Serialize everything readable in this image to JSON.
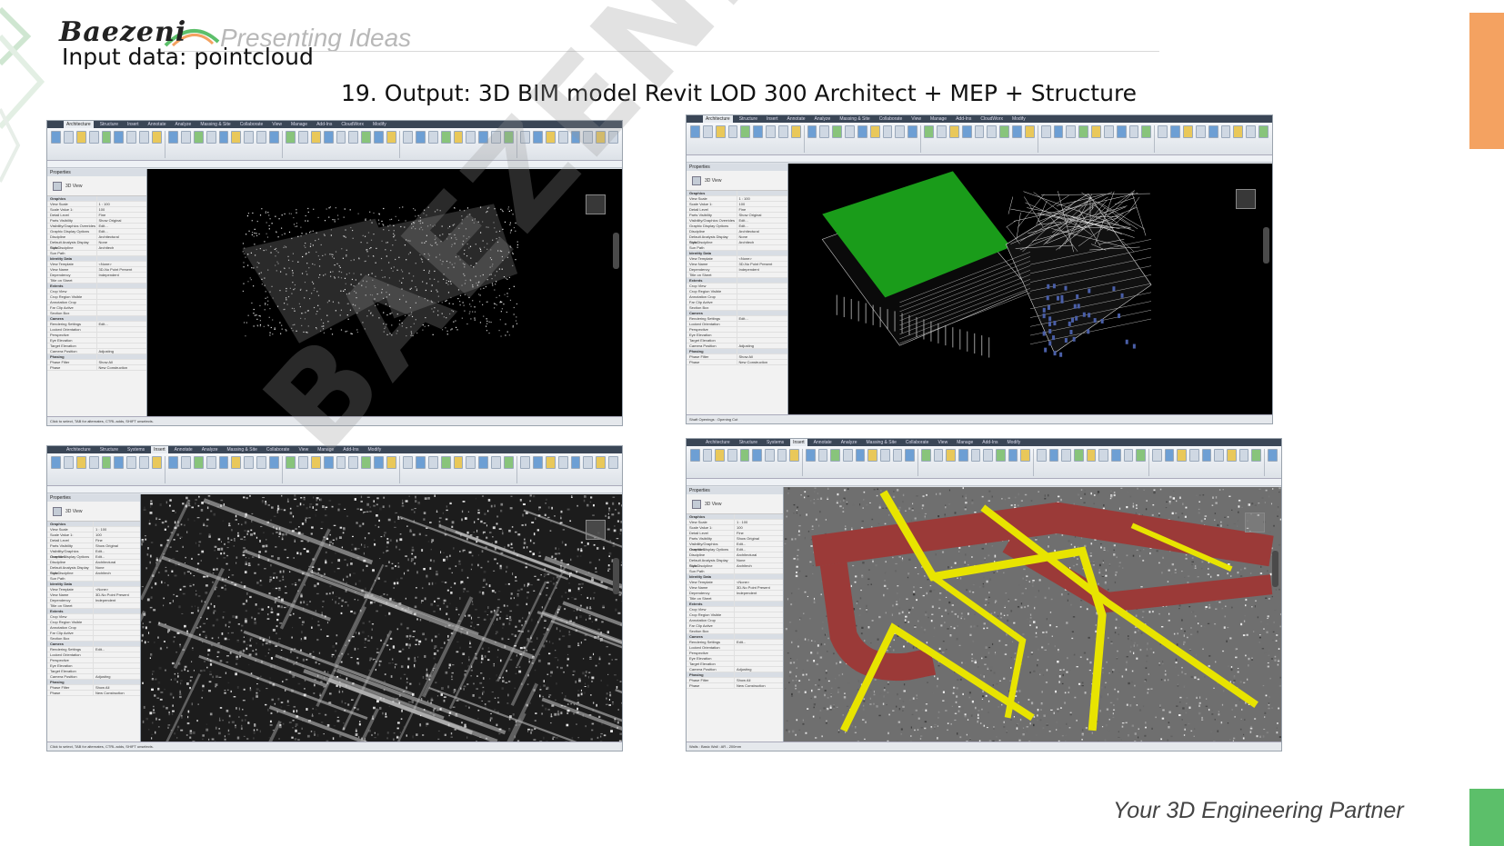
{
  "header": {
    "logo_text": "Baezeni",
    "tagline": "Presenting Ideas",
    "subtitle": "Input data: pointcloud",
    "title": "19. Output: 3D BIM model Revit LOD 300 Architect + MEP + Structure"
  },
  "footer": {
    "tagline": "Your 3D Engineering Partner"
  },
  "watermark": "BAEZENI.COM",
  "colors": {
    "accent_orange": "#f4a261",
    "accent_green": "#5cbf6a",
    "roof_green": "#1a9c1a",
    "pipe_yellow": "#e8e400",
    "duct_red": "#9b3a38"
  },
  "windows": [
    {
      "tabs": [
        "Architecture",
        "Structure",
        "Insert",
        "Annotate",
        "Analyze",
        "Massing & Site",
        "Collaborate",
        "View",
        "Manage",
        "Add-Ins",
        "CloudWorx",
        "Modify"
      ],
      "active_tab": "Architecture",
      "props_title": "Properties",
      "view_type": "3D View",
      "status": "Click to select, TAB for alternates, CTRL adds, SHIFT unselects.",
      "content": "pointcloud-building"
    },
    {
      "tabs": [
        "Architecture",
        "Structure",
        "Insert",
        "Annotate",
        "Analyze",
        "Massing & Site",
        "Collaborate",
        "View",
        "Manage",
        "Add-Ins",
        "CloudWorx",
        "Modify"
      ],
      "active_tab": "Architecture",
      "props_title": "Properties",
      "view_type": "3D View",
      "status": "Shaft Openings : Opening Cut",
      "content": "bim-building"
    },
    {
      "tabs": [
        "Architecture",
        "Structure",
        "Systems",
        "Insert",
        "Annotate",
        "Analyze",
        "Massing & Site",
        "Collaborate",
        "View",
        "Manage",
        "Add-Ins",
        "Modify"
      ],
      "active_tab": "Insert",
      "props_title": "Properties",
      "view_type": "3D View",
      "status": "Click to select, TAB for alternates, CTRL adds, SHIFT unselects.",
      "content": "pointcloud-interior"
    },
    {
      "tabs": [
        "Architecture",
        "Structure",
        "Systems",
        "Insert",
        "Annotate",
        "Analyze",
        "Massing & Site",
        "Collaborate",
        "View",
        "Manage",
        "Add-Ins",
        "Modify"
      ],
      "active_tab": "Insert",
      "props_title": "Properties",
      "view_type": "3D View",
      "status": "Walls : Basic Wall : AR - 200mm",
      "content": "mep-interior"
    }
  ],
  "properties": [
    {
      "k": "Graphics",
      "v": "",
      "sect": true
    },
    {
      "k": "View Scale",
      "v": "1 : 100"
    },
    {
      "k": "Scale Value 1:",
      "v": "100"
    },
    {
      "k": "Detail Level",
      "v": "Fine"
    },
    {
      "k": "Parts Visibility",
      "v": "Show Original"
    },
    {
      "k": "Visibility/Graphics Overrides",
      "v": "Edit..."
    },
    {
      "k": "Graphic Display Options",
      "v": "Edit..."
    },
    {
      "k": "Discipline",
      "v": "Architectural"
    },
    {
      "k": "Default Analysis Display Style",
      "v": "None"
    },
    {
      "k": "Sub-Discipline",
      "v": "Architech"
    },
    {
      "k": "Sun Path",
      "v": ""
    },
    {
      "k": "Identity Data",
      "v": "",
      "sect": true
    },
    {
      "k": "View Template",
      "v": "<None>"
    },
    {
      "k": "View Name",
      "v": "3D-No Point Present"
    },
    {
      "k": "Dependency",
      "v": "Independent"
    },
    {
      "k": "Title on Sheet",
      "v": ""
    },
    {
      "k": "Extents",
      "v": "",
      "sect": true
    },
    {
      "k": "Crop View",
      "v": ""
    },
    {
      "k": "Crop Region Visible",
      "v": ""
    },
    {
      "k": "Annotation Crop",
      "v": ""
    },
    {
      "k": "Far Clip Active",
      "v": ""
    },
    {
      "k": "Section Box",
      "v": ""
    },
    {
      "k": "Camera",
      "v": "",
      "sect": true
    },
    {
      "k": "Rendering Settings",
      "v": "Edit..."
    },
    {
      "k": "Locked Orientation",
      "v": ""
    },
    {
      "k": "Perspective",
      "v": ""
    },
    {
      "k": "Eye Elevation",
      "v": ""
    },
    {
      "k": "Target Elevation",
      "v": ""
    },
    {
      "k": "Camera Position",
      "v": "Adjusting"
    },
    {
      "k": "Phasing",
      "v": "",
      "sect": true
    },
    {
      "k": "Phase Filter",
      "v": "Show All"
    },
    {
      "k": "Phase",
      "v": "New Construction"
    }
  ]
}
